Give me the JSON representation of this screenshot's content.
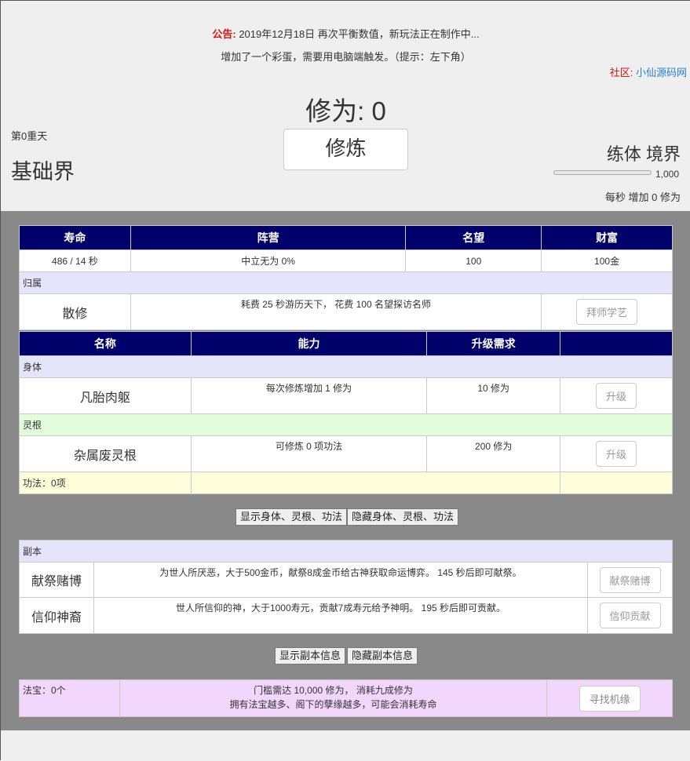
{
  "header": {
    "notice_label": "公告:",
    "notice_text": "2019年12月18日 再次平衡数值，新玩法正在制作中...",
    "notice2": "增加了一个彩蛋，需要用电脑端触发。（提示：左下角）",
    "community_label": "社区:",
    "community_link": "小仙源码网",
    "cultivation": "修为: 0",
    "train_button": "修炼",
    "heaven_day": "第0重天",
    "world": "基础界",
    "realm": "练体 境界",
    "progress_value": "1,000",
    "progress_fraction": 0,
    "per_second": "每秒 增加 0 修为"
  },
  "stats": {
    "headers": [
      "寿命",
      "阵营",
      "名望",
      "财富"
    ],
    "values": [
      "486 / 14 秒",
      "中立无为 0%",
      "100",
      "100金"
    ]
  },
  "belong": {
    "section": "归属",
    "name": "散修",
    "desc": "耗费 25 秒游历天下， 花费 100 名望探访名师",
    "button": "拜师学艺"
  },
  "abilities": {
    "headers": [
      "名称",
      "能力",
      "升级需求",
      ""
    ],
    "body_section": "身体",
    "body_name": "凡胎肉躯",
    "body_desc": "每次修炼增加 1 修为",
    "body_req": "10 修为",
    "body_button": "升级",
    "root_section": "灵根",
    "root_name": "杂属废灵根",
    "root_desc": "可修炼 0 项功法",
    "root_req": "200 修为",
    "root_button": "升级",
    "skills": "功法：0项"
  },
  "toggle1": {
    "show": "显示身体、灵根、功法",
    "hide": "隐藏身体、灵根、功法"
  },
  "dungeon": {
    "section": "副本",
    "row1_name": "献祭赌博",
    "row1_desc": "为世人所厌恶，大于500金币，献祭8成金币给古神获取命运博弈。 145 秒后即可献祭。",
    "row1_button": "献祭赌博",
    "row2_name": "信仰神裔",
    "row2_desc": "世人所信仰的神，大于1000寿元，贡献7成寿元给予神明。 195 秒后即可贡献。",
    "row2_button": "信仰贡献"
  },
  "toggle2": {
    "show": "显示副本信息",
    "hide": "隐藏副本信息"
  },
  "treasure": {
    "label": "法宝：0个",
    "line1": "门槛需达 10,000 修为， 消耗九成修为",
    "line2": "拥有法宝越多、阁下的孽缘越多，可能会消耗寿命",
    "button": "寻找机缘"
  }
}
